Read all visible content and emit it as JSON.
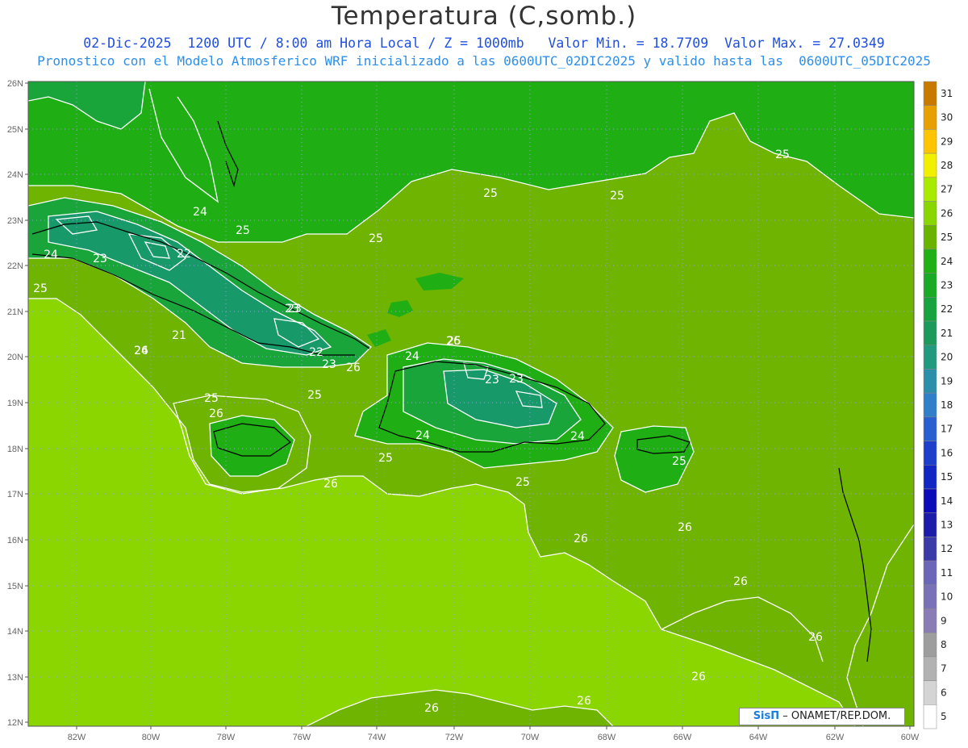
{
  "header": {
    "title": "Temperatura (C,somb.)",
    "line1": "02-Dic-2025  1200 UTC / 8:00 am Hora Local / Z = 1000mb   Valor Min. = 18.7709  Valor Max. = 27.0349",
    "line2": "Pronostico con el Modelo Atmosferico WRF inicializado a las 0600UTC_02DIC2025 y valido hasta las  0600UTC_05DIC2025"
  },
  "credit": {
    "brand": "SisΠ",
    "text": "– ONAMET/REP.DOM."
  },
  "chart_data": {
    "type": "heatmap",
    "x_axis": {
      "ticks": [
        "82W",
        "80W",
        "78W",
        "76W",
        "74W",
        "72W",
        "70W",
        "68W",
        "66W",
        "64W",
        "62W",
        "60W"
      ]
    },
    "y_axis": {
      "ticks": [
        "26N",
        "25N",
        "24N",
        "23N",
        "22N",
        "21N",
        "20N",
        "19N",
        "18N",
        "17N",
        "16N",
        "15N",
        "14N",
        "13N",
        "12N"
      ]
    },
    "colorbar": {
      "levels": [
        "5",
        "6",
        "7",
        "8",
        "9",
        "10",
        "11",
        "12",
        "13",
        "14",
        "15",
        "16",
        "17",
        "18",
        "19",
        "20",
        "21",
        "22",
        "23",
        "24",
        "25",
        "26",
        "27",
        "28",
        "29",
        "30",
        "31"
      ],
      "colors": [
        "#ffffff",
        "#d4d4d4",
        "#b2b2b2",
        "#9e9e9e",
        "#8a7cb5",
        "#7a72b6",
        "#6c66b8",
        "#3a3aa8",
        "#1c1caa",
        "#0b0bb8",
        "#1226c4",
        "#1d3fcb",
        "#2a5fd1",
        "#2f7fc9",
        "#2b8faa",
        "#229a80",
        "#1b9a5c",
        "#17a43f",
        "#19ab26",
        "#20b115",
        "#6ab400",
        "#8ad600",
        "#a8ea00",
        "#f0f000",
        "#ffc400",
        "#e6a000",
        "#c87a00"
      ]
    },
    "contour_labels": [
      "25",
      "25",
      "25",
      "24",
      "25",
      "25",
      "24",
      "23",
      "22",
      "25",
      "23",
      "21",
      "22",
      "23",
      "24",
      "26",
      "25",
      "24",
      "26",
      "25",
      "26",
      "25",
      "24",
      "23",
      "23",
      "23",
      "24",
      "25",
      "25",
      "26",
      "26",
      "26",
      "26",
      "26",
      "26",
      "26",
      "26",
      "26",
      "25",
      "26",
      "26"
    ]
  }
}
